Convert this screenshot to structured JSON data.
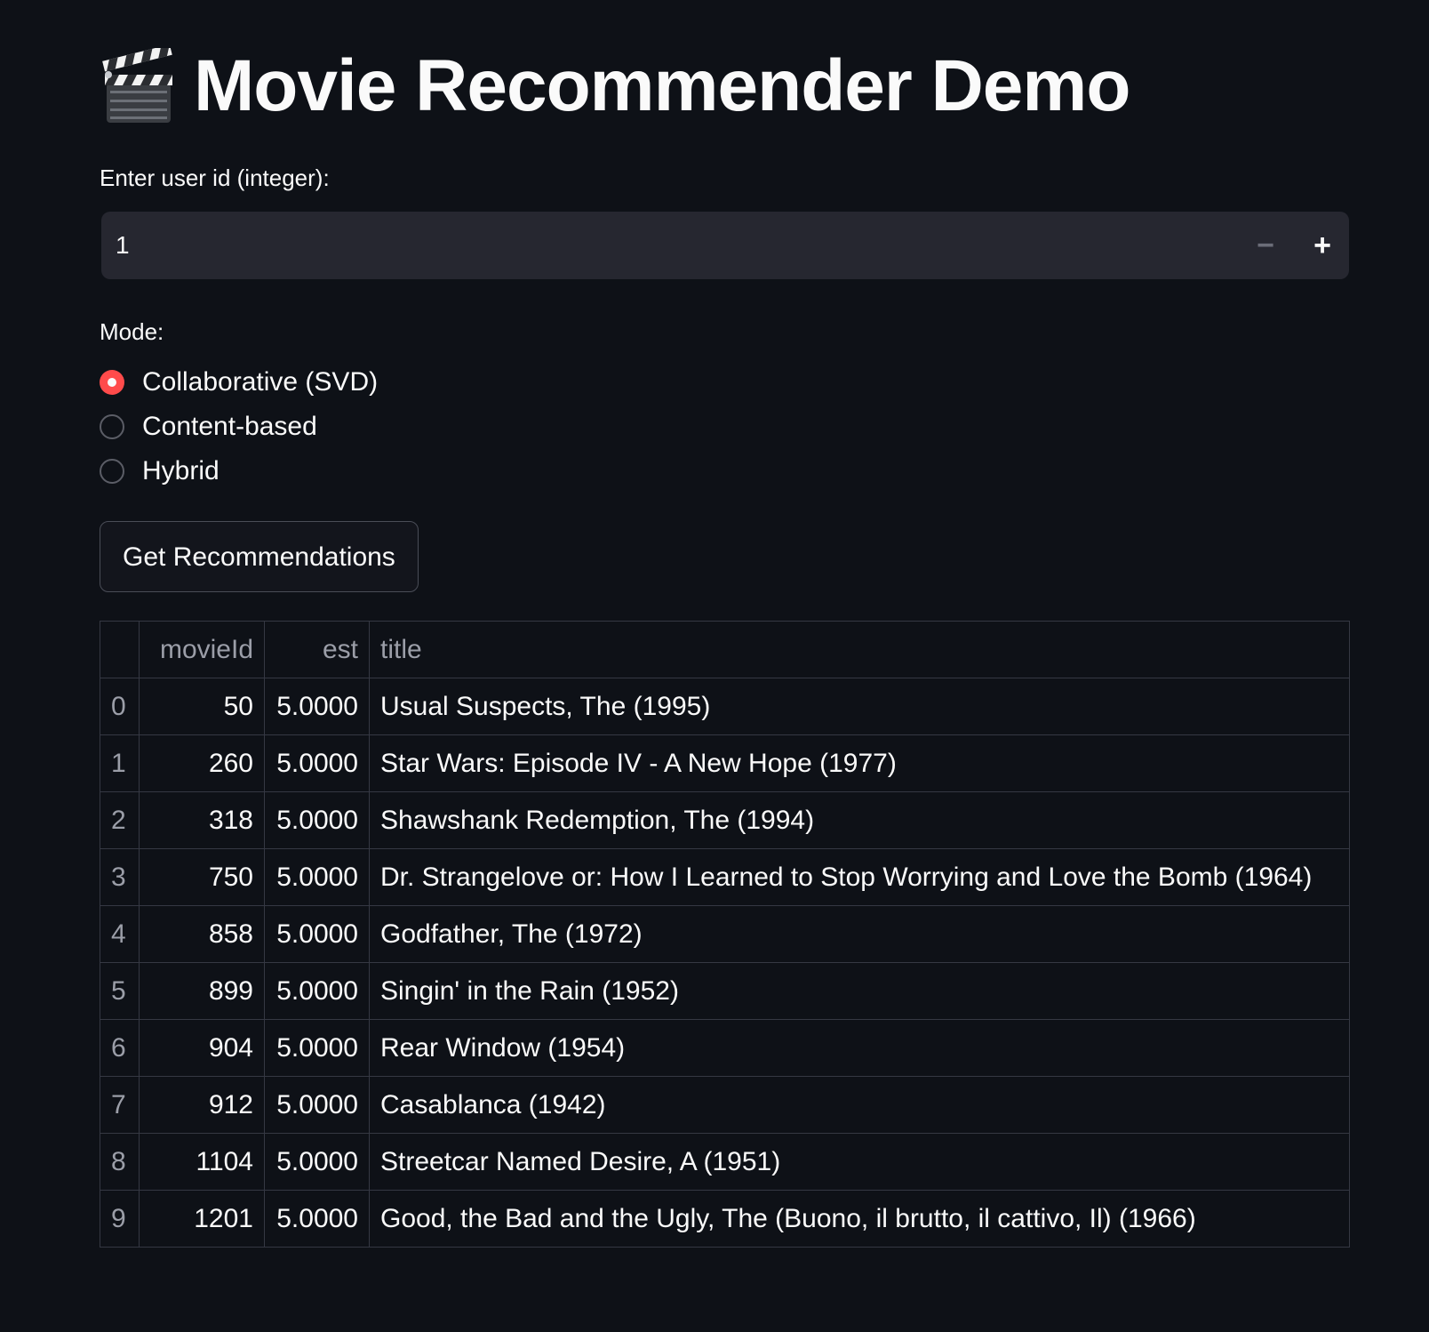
{
  "app": {
    "title": "Movie Recommender Demo",
    "title_icon": "clapper-board-icon"
  },
  "user_input": {
    "label": "Enter user id (integer):",
    "value": "1",
    "decrement_symbol": "−",
    "increment_symbol": "+"
  },
  "mode": {
    "label": "Mode:",
    "options": [
      "Collaborative (SVD)",
      "Content-based",
      "Hybrid"
    ],
    "selected": "Collaborative (SVD)"
  },
  "actions": {
    "get_recommendations_label": "Get Recommendations"
  },
  "results": {
    "columns": [
      "",
      "movieId",
      "est",
      "title"
    ],
    "rows": [
      {
        "index": "0",
        "movieId": "50",
        "est": "5.0000",
        "title": "Usual Suspects, The (1995)"
      },
      {
        "index": "1",
        "movieId": "260",
        "est": "5.0000",
        "title": "Star Wars: Episode IV - A New Hope (1977)"
      },
      {
        "index": "2",
        "movieId": "318",
        "est": "5.0000",
        "title": "Shawshank Redemption, The (1994)"
      },
      {
        "index": "3",
        "movieId": "750",
        "est": "5.0000",
        "title": "Dr. Strangelove or: How I Learned to Stop Worrying and Love the Bomb (1964)"
      },
      {
        "index": "4",
        "movieId": "858",
        "est": "5.0000",
        "title": "Godfather, The (1972)"
      },
      {
        "index": "5",
        "movieId": "899",
        "est": "5.0000",
        "title": "Singin' in the Rain (1952)"
      },
      {
        "index": "6",
        "movieId": "904",
        "est": "5.0000",
        "title": "Rear Window (1954)"
      },
      {
        "index": "7",
        "movieId": "912",
        "est": "5.0000",
        "title": "Casablanca (1942)"
      },
      {
        "index": "8",
        "movieId": "1104",
        "est": "5.0000",
        "title": "Streetcar Named Desire, A (1951)"
      },
      {
        "index": "9",
        "movieId": "1201",
        "est": "5.0000",
        "title": "Good, the Bad and the Ugly, The (Buono, il brutto, il cattivo, Il) (1966)"
      }
    ]
  },
  "colors": {
    "background": "#0e1117",
    "input_background": "#262730",
    "accent": "#ff4b4b",
    "text": "#fafafa",
    "muted_text": "#9b9ea8",
    "grid": "#353843"
  }
}
